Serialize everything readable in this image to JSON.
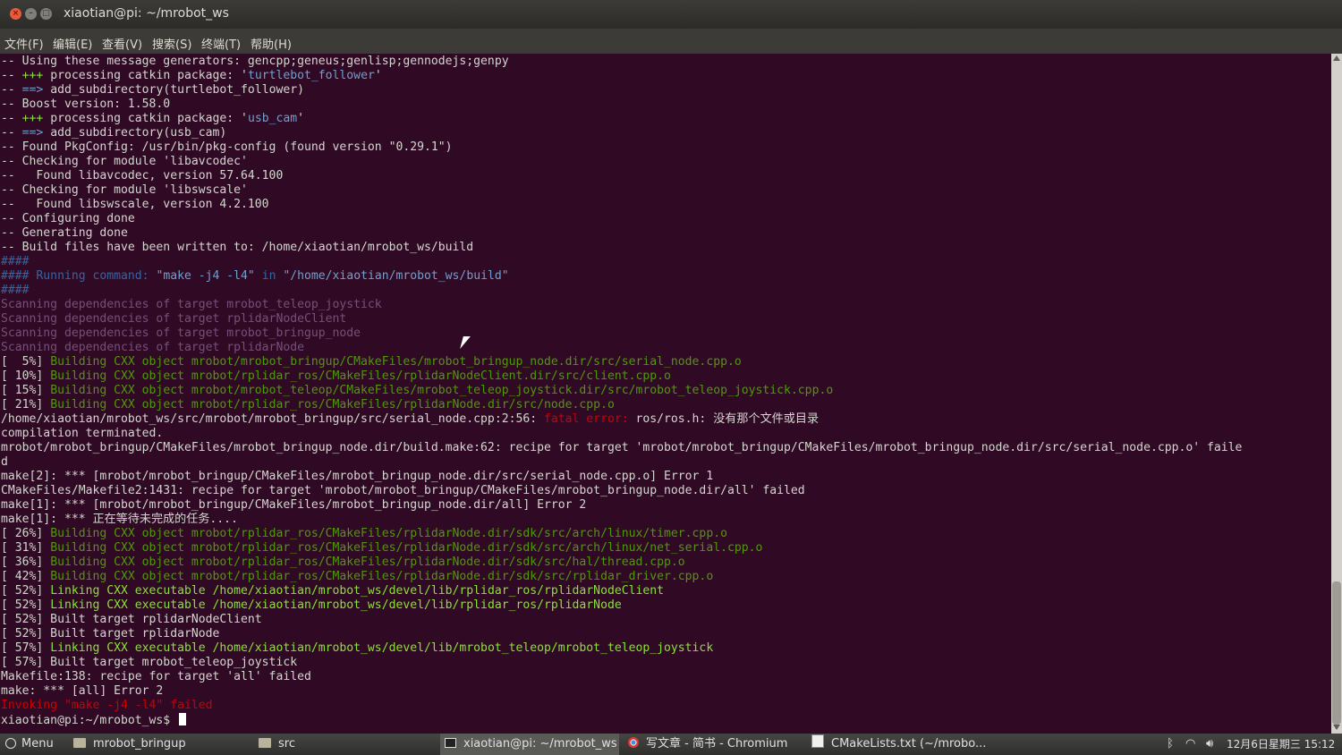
{
  "window": {
    "title": "xiaotian@pi: ~/mrobot_ws"
  },
  "menu": [
    "文件(F)",
    "编辑(E)",
    "查看(V)",
    "搜索(S)",
    "终端(T)",
    "帮助(H)"
  ],
  "terminal": {
    "lines": [
      [
        [
          "-- Using these message generators: gencpp;geneus;genlisp;gennodejs;genpy",
          "default"
        ]
      ],
      [
        [
          "-- ",
          "default"
        ],
        [
          "+++",
          "bgreen"
        ],
        [
          " processing catkin package: '",
          "default"
        ],
        [
          "turtlebot_follower",
          "blue"
        ],
        [
          "'",
          "default"
        ]
      ],
      [
        [
          "-- ",
          "default"
        ],
        [
          "==>",
          "blue"
        ],
        [
          " add_subdirectory(turtlebot_follower)",
          "default"
        ]
      ],
      [
        [
          "-- Boost version: 1.58.0",
          "default"
        ]
      ],
      [
        [
          "-- ",
          "default"
        ],
        [
          "+++",
          "bgreen"
        ],
        [
          " processing catkin package: '",
          "default"
        ],
        [
          "usb_cam",
          "blue"
        ],
        [
          "'",
          "default"
        ]
      ],
      [
        [
          "-- ",
          "default"
        ],
        [
          "==>",
          "blue"
        ],
        [
          " add_subdirectory(usb_cam)",
          "default"
        ]
      ],
      [
        [
          "-- Found PkgConfig: /usr/bin/pkg-config (found version \"0.29.1\")",
          "default"
        ]
      ],
      [
        [
          "-- Checking for module 'libavcodec'",
          "default"
        ]
      ],
      [
        [
          "--   Found libavcodec, version 57.64.100",
          "default"
        ]
      ],
      [
        [
          "-- Checking for module 'libswscale'",
          "default"
        ]
      ],
      [
        [
          "--   Found libswscale, version 4.2.100",
          "default"
        ]
      ],
      [
        [
          "-- Configuring done",
          "default"
        ]
      ],
      [
        [
          "-- Generating done",
          "default"
        ]
      ],
      [
        [
          "-- Build files have been written to: /home/xiaotian/mrobot_ws/build",
          "default"
        ]
      ],
      [
        [
          "####",
          "dblue"
        ]
      ],
      [
        [
          "#### Running command: ",
          "dblue"
        ],
        [
          "\"make -j4 -l4\"",
          "blue"
        ],
        [
          " in ",
          "dblue"
        ],
        [
          "\"/home/xiaotian/mrobot_ws/build\"",
          "blue"
        ]
      ],
      [
        [
          "####",
          "dblue"
        ]
      ],
      [
        [
          "Scanning dependencies of target mrobot_teleop_joystick",
          "magenta"
        ]
      ],
      [
        [
          "Scanning dependencies of target rplidarNodeClient",
          "magenta"
        ]
      ],
      [
        [
          "Scanning dependencies of target mrobot_bringup_node",
          "magenta"
        ]
      ],
      [
        [
          "Scanning dependencies of target rplidarNode",
          "magenta"
        ]
      ],
      [
        [
          "[  5%] ",
          "default"
        ],
        [
          "Building CXX object mrobot/mrobot_bringup/CMakeFiles/mrobot_bringup_node.dir/src/serial_node.cpp.o",
          "green"
        ]
      ],
      [
        [
          "[ 10%] ",
          "default"
        ],
        [
          "Building CXX object mrobot/rplidar_ros/CMakeFiles/rplidarNodeClient.dir/src/client.cpp.o",
          "green"
        ]
      ],
      [
        [
          "[ 15%] ",
          "default"
        ],
        [
          "Building CXX object mrobot/mrobot_teleop/CMakeFiles/mrobot_teleop_joystick.dir/src/mrobot_teleop_joystick.cpp.o",
          "green"
        ]
      ],
      [
        [
          "[ 21%] ",
          "default"
        ],
        [
          "Building CXX object mrobot/rplidar_ros/CMakeFiles/rplidarNode.dir/src/node.cpp.o",
          "green"
        ]
      ],
      [
        [
          "/home/xiaotian/mrobot_ws/src/mrobot/mrobot_bringup/src/serial_node.cpp:2:56: ",
          "default"
        ],
        [
          "fatal error: ",
          "red"
        ],
        [
          "ros/ros.h: 没有那个文件或目录",
          "default"
        ]
      ],
      [
        [
          "compilation terminated.",
          "default"
        ]
      ],
      [
        [
          "mrobot/mrobot_bringup/CMakeFiles/mrobot_bringup_node.dir/build.make:62: recipe for target 'mrobot/mrobot_bringup/CMakeFiles/mrobot_bringup_node.dir/src/serial_node.cpp.o' faile",
          "default"
        ]
      ],
      [
        [
          "d",
          "default"
        ]
      ],
      [
        [
          "make[2]: *** [mrobot/mrobot_bringup/CMakeFiles/mrobot_bringup_node.dir/src/serial_node.cpp.o] Error 1",
          "default"
        ]
      ],
      [
        [
          "CMakeFiles/Makefile2:1431: recipe for target 'mrobot/mrobot_bringup/CMakeFiles/mrobot_bringup_node.dir/all' failed",
          "default"
        ]
      ],
      [
        [
          "make[1]: *** [mrobot/mrobot_bringup/CMakeFiles/mrobot_bringup_node.dir/all] Error 2",
          "default"
        ]
      ],
      [
        [
          "make[1]: *** 正在等待未完成的任务....",
          "default"
        ]
      ],
      [
        [
          "[ 26%] ",
          "default"
        ],
        [
          "Building CXX object mrobot/rplidar_ros/CMakeFiles/rplidarNode.dir/sdk/src/arch/linux/timer.cpp.o",
          "green"
        ]
      ],
      [
        [
          "[ 31%] ",
          "default"
        ],
        [
          "Building CXX object mrobot/rplidar_ros/CMakeFiles/rplidarNode.dir/sdk/src/arch/linux/net_serial.cpp.o",
          "green"
        ]
      ],
      [
        [
          "[ 36%] ",
          "default"
        ],
        [
          "Building CXX object mrobot/rplidar_ros/CMakeFiles/rplidarNode.dir/sdk/src/hal/thread.cpp.o",
          "green"
        ]
      ],
      [
        [
          "[ 42%] ",
          "default"
        ],
        [
          "Building CXX object mrobot/rplidar_ros/CMakeFiles/rplidarNode.dir/sdk/src/rplidar_driver.cpp.o",
          "green"
        ]
      ],
      [
        [
          "[ 52%] ",
          "default"
        ],
        [
          "Linking CXX executable /home/xiaotian/mrobot_ws/devel/lib/rplidar_ros/rplidarNodeClient",
          "bgreen"
        ]
      ],
      [
        [
          "[ 52%] ",
          "default"
        ],
        [
          "Linking CXX executable /home/xiaotian/mrobot_ws/devel/lib/rplidar_ros/rplidarNode",
          "bgreen"
        ]
      ],
      [
        [
          "[ 52%] Built target rplidarNodeClient",
          "default"
        ]
      ],
      [
        [
          "[ 52%] Built target rplidarNode",
          "default"
        ]
      ],
      [
        [
          "[ 57%] ",
          "default"
        ],
        [
          "Linking CXX executable /home/xiaotian/mrobot_ws/devel/lib/mrobot_teleop/mrobot_teleop_joystick",
          "bgreen"
        ]
      ],
      [
        [
          "[ 57%] Built target mrobot_teleop_joystick",
          "default"
        ]
      ],
      [
        [
          "Makefile:138: recipe for target 'all' failed",
          "default"
        ]
      ],
      [
        [
          "make: *** [all] Error 2",
          "default"
        ]
      ],
      [
        [
          "Invoking \"make -j4 -l4\" failed",
          "red"
        ]
      ]
    ],
    "prompt": "xiaotian@pi:~/mrobot_ws$ "
  },
  "taskbar": {
    "menu_label": "Menu",
    "items": [
      {
        "label": "mrobot_bringup",
        "icon": "folder-icon"
      },
      {
        "label": "src",
        "icon": "folder-icon"
      },
      {
        "label": "xiaotian@pi: ~/mrobot_ws",
        "icon": "terminal-icon"
      },
      {
        "label": "写文章 - 简书 - Chromium",
        "icon": "chromium-icon"
      },
      {
        "label": "CMakeLists.txt (~/mrobo...",
        "icon": "text-editor-icon"
      }
    ],
    "clock": "12月6日星期三 15:12"
  }
}
